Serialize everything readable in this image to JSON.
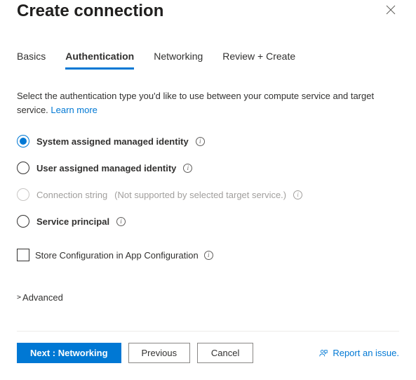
{
  "header": {
    "title": "Create connection"
  },
  "tabs": {
    "basics": "Basics",
    "authentication": "Authentication",
    "networking": "Networking",
    "review": "Review + Create"
  },
  "description": {
    "text": "Select the authentication type you'd like to use between your compute service and target service.",
    "learn_more": "Learn more"
  },
  "options": {
    "system_identity": "System assigned managed identity",
    "user_identity": "User assigned managed identity",
    "connection_string": "Connection string",
    "connection_string_note": "(Not supported by selected target service.)",
    "service_principal": "Service principal"
  },
  "checkbox": {
    "store_config": "Store Configuration in App Configuration"
  },
  "advanced": {
    "label": "Advanced"
  },
  "footer": {
    "next": "Next : Networking",
    "previous": "Previous",
    "cancel": "Cancel",
    "report": "Report an issue."
  }
}
